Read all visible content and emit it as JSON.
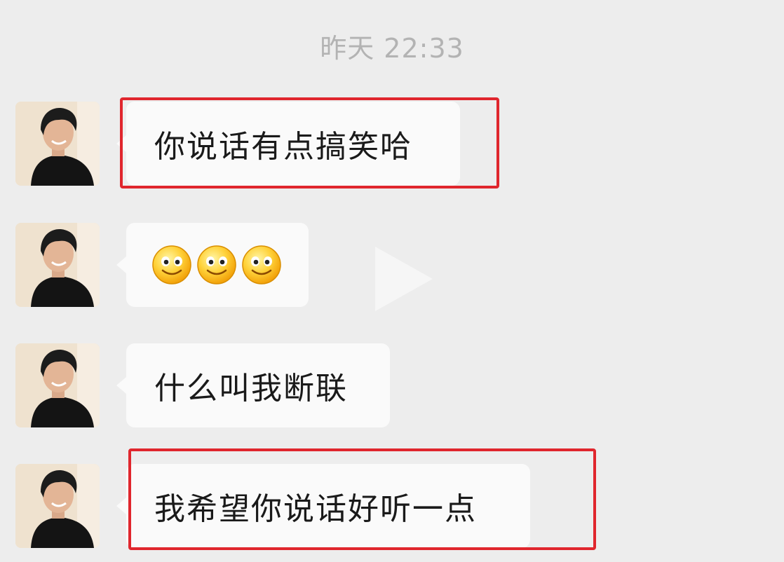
{
  "timestamp": "昨天 22:33",
  "messages": [
    {
      "type": "text",
      "text": "你说话有点搞笑哈",
      "highlighted": true
    },
    {
      "type": "emoji",
      "emoji": [
        "smile-face",
        "smile-face",
        "smile-face"
      ],
      "highlighted": false
    },
    {
      "type": "text",
      "text": "什么叫我断联",
      "highlighted": false
    },
    {
      "type": "text",
      "text": "我希望你说话好听一点",
      "highlighted": true
    }
  ],
  "colors": {
    "background": "#ededed",
    "bubble": "#fafafa",
    "highlight": "#e0262d",
    "timestamp": "#b3b3b3"
  }
}
